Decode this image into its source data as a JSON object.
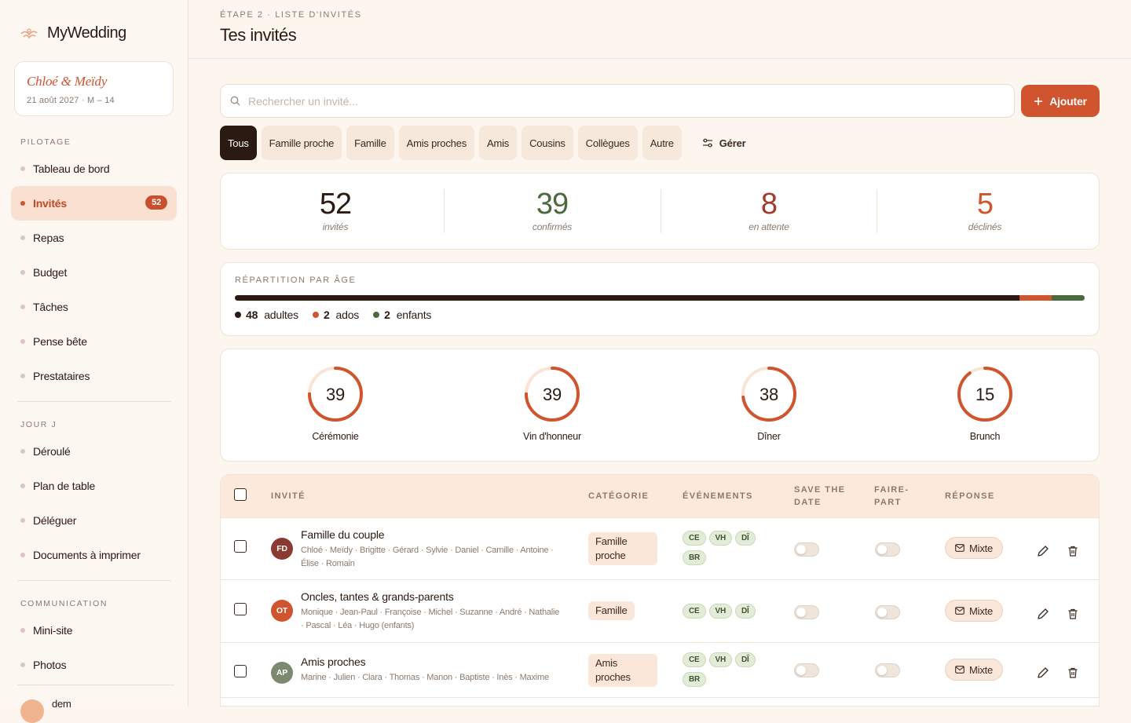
{
  "brand": {
    "name": "MyWedding"
  },
  "couple": {
    "names": "Chloé & Meïdy",
    "date": "21 août 2027 · M – 14"
  },
  "sidebar": {
    "sections": [
      {
        "label": "PILOTAGE"
      },
      {
        "label": "JOUR J"
      },
      {
        "label": "COMMUNICATION"
      }
    ],
    "items": [
      {
        "label": "Tableau de bord"
      },
      {
        "label": "Invités",
        "badge": "52"
      },
      {
        "label": "Repas"
      },
      {
        "label": "Budget"
      },
      {
        "label": "Tâches"
      },
      {
        "label": "Pense bête"
      },
      {
        "label": "Prestataires"
      },
      {
        "label": "Déroulé"
      },
      {
        "label": "Plan de table"
      },
      {
        "label": "Déléguer"
      },
      {
        "label": "Documents à imprimer"
      },
      {
        "label": "Mini-site"
      },
      {
        "label": "Photos"
      }
    ],
    "user": {
      "name": "dem"
    }
  },
  "header": {
    "step": "ÉTAPE 2 · LISTE D'INVITÉS",
    "title": "Tes invités"
  },
  "search": {
    "placeholder": "Rechercher un invité..."
  },
  "add_button": {
    "label": "Ajouter"
  },
  "filters": {
    "chips": [
      "Tous",
      "Famille proche",
      "Famille",
      "Amis proches",
      "Amis",
      "Cousins",
      "Collègues",
      "Autre"
    ],
    "active": "Tous",
    "manage_label": "Gérer"
  },
  "stats": [
    {
      "value": "52",
      "label": "invités",
      "color": "#2a1a12"
    },
    {
      "value": "39",
      "label": "confirmés",
      "color": "#4a6a3e"
    },
    {
      "value": "8",
      "label": "en attente",
      "color": "#a33a2c"
    },
    {
      "value": "5",
      "label": "déclinés",
      "color": "#d0542e"
    }
  ],
  "age": {
    "title": "RÉPARTITION PAR ÂGE",
    "groups": [
      {
        "count": "48",
        "label": "adultes",
        "value": 48,
        "color": "#2a1a12"
      },
      {
        "count": "2",
        "label": "ados",
        "value": 2,
        "color": "#d0542e"
      },
      {
        "count": "2",
        "label": "enfants",
        "value": 2,
        "color": "#4a6a3e"
      }
    ]
  },
  "events_summary": [
    {
      "value": "39",
      "label": "Cérémonie",
      "fraction": 0.75
    },
    {
      "value": "39",
      "label": "Vin d'honneur",
      "fraction": 0.75
    },
    {
      "value": "38",
      "label": "Dîner",
      "fraction": 0.73
    },
    {
      "value": "15",
      "label": "Brunch",
      "fraction": 0.9
    }
  ],
  "table": {
    "headers": {
      "guest": "INVITÉ",
      "category": "CATÉGORIE",
      "events": "ÉVÉNEMENTS",
      "save_the_date": [
        "SAVE THE",
        "DATE"
      ],
      "invitation": [
        "FAIRE-",
        "PART"
      ],
      "response": "RÉPONSE"
    },
    "rows": [
      {
        "initials": "FD",
        "avatar_color": "#8b3a32",
        "name": "Famille du couple",
        "members": "Chloé · Meïdy · Brigitte · Gérard · Sylvie · Daniel · Camille · Antoine · Élise · Romain",
        "category": "Famille proche",
        "events": [
          "CE",
          "VH",
          "DÎ",
          "BR"
        ],
        "response": "Mixte"
      },
      {
        "initials": "OT",
        "avatar_color": "#d0542e",
        "name": "Oncles, tantes & grands-parents",
        "members": "Monique · Jean-Paul · Françoise · Michel · Suzanne · André · Nathalie · Pascal · Léa · Hugo (enfants)",
        "category": "Famille",
        "events": [
          "CE",
          "VH",
          "DÎ"
        ],
        "response": "Mixte"
      },
      {
        "initials": "AP",
        "avatar_color": "#7b8a6e",
        "name": "Amis proches",
        "members": "Marine · Julien · Clara · Thomas · Manon · Baptiste · Inès · Maxime",
        "category": "Amis proches",
        "events": [
          "CE",
          "VH",
          "DÎ",
          "BR"
        ],
        "response": "Mixte"
      }
    ]
  }
}
